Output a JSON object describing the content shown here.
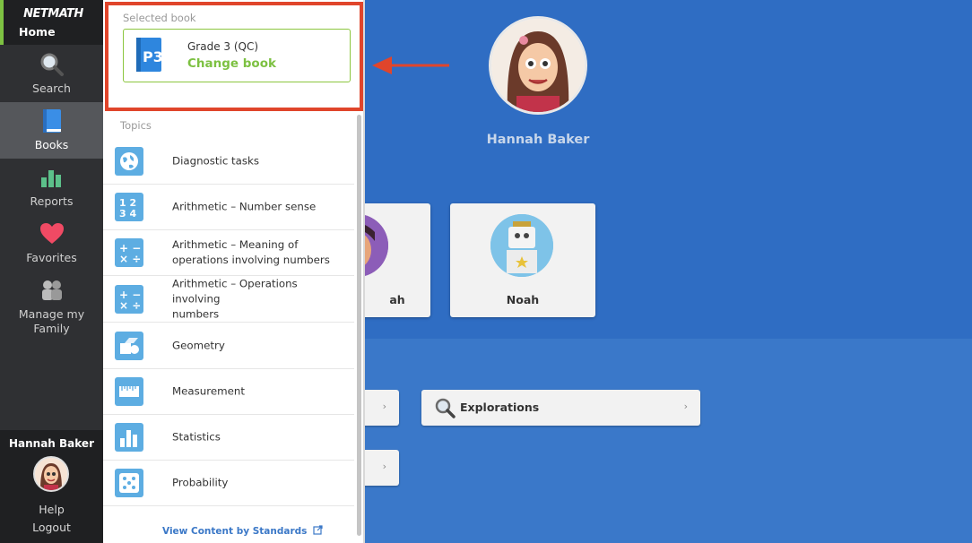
{
  "sidebar": {
    "logo": "NETMATH",
    "home_label": "Home",
    "items": [
      {
        "label": "Search",
        "icon": "magnifier-icon"
      },
      {
        "label": "Books",
        "icon": "book-icon",
        "active": true
      },
      {
        "label": "Reports",
        "icon": "bar-chart-icon"
      },
      {
        "label": "Favorites",
        "icon": "heart-icon"
      },
      {
        "label": "Manage my",
        "label2": "Family",
        "icon": "family-icon"
      }
    ],
    "user_name": "Hannah Baker",
    "help": "Help",
    "logout": "Logout"
  },
  "panel": {
    "selected_label": "Selected book",
    "book_grade": "Grade 3 (QC)",
    "change_book": "Change book",
    "topics_label": "Topics",
    "topics": [
      {
        "line1": "Diagnostic tasks",
        "line2": "",
        "icon": "globe-icon"
      },
      {
        "line1": "Arithmetic – Number sense",
        "line2": "",
        "icon": "numbers-icon"
      },
      {
        "line1": "Arithmetic – Meaning of",
        "line2": "operations involving numbers",
        "icon": "operations-icon"
      },
      {
        "line1": "Arithmetic – Operations involving",
        "line2": "numbers",
        "icon": "operations-icon"
      },
      {
        "line1": "Geometry",
        "line2": "",
        "icon": "shapes-icon"
      },
      {
        "line1": "Measurement",
        "line2": "",
        "icon": "ruler-icon"
      },
      {
        "line1": "Statistics",
        "line2": "",
        "icon": "bar-chart-icon"
      },
      {
        "line1": "Probability",
        "line2": "",
        "icon": "dice-icon"
      }
    ],
    "standards_link": "View Content by Standards"
  },
  "main": {
    "user_name": "Hannah Baker",
    "children": [
      {
        "name": "ah"
      },
      {
        "name": "Noah"
      }
    ],
    "explorations": "Explorations"
  },
  "colors": {
    "accent_green": "#7dc142",
    "highlight_red": "#e0452b",
    "main_blue": "#2f6dc3",
    "sidebar_dark": "#2f3033",
    "topic_icon_blue": "#5dade2"
  }
}
